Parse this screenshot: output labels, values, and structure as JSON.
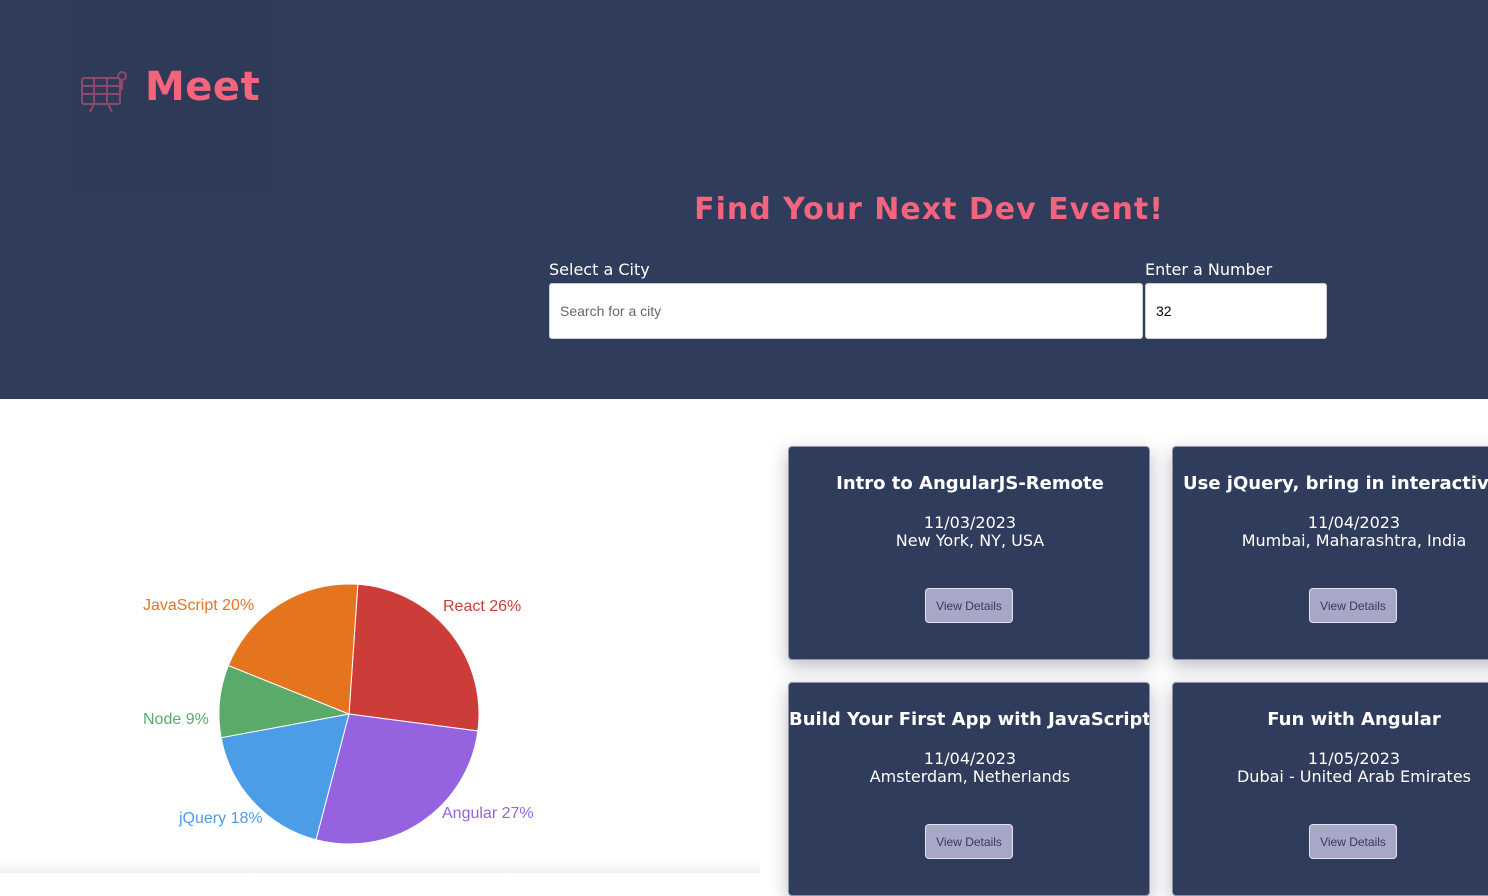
{
  "app": {
    "logo_text": "Meet",
    "headline": "Find Your Next Dev Event!"
  },
  "search": {
    "city_label": "Select a City",
    "city_placeholder": "Search for a city",
    "city_value": "",
    "number_label": "Enter a Number",
    "number_value": "32"
  },
  "chart_data": {
    "type": "pie",
    "slices": [
      {
        "label": "React",
        "percent": 26,
        "color": "#cc3c38"
      },
      {
        "label": "Angular",
        "percent": 27,
        "color": "#9563e0"
      },
      {
        "label": "jQuery",
        "percent": 18,
        "color": "#4c9de8"
      },
      {
        "label": "Node",
        "percent": 9,
        "color": "#5aab69"
      },
      {
        "label": "JavaScript",
        "percent": 20,
        "color": "#e5741f"
      }
    ]
  },
  "events": [
    {
      "title": "Intro to AngularJS-Remote",
      "date": "11/03/2023",
      "location": "New York, NY, USA",
      "button": "View Details"
    },
    {
      "title": "Use jQuery, bring in interactivity easily",
      "date": "11/04/2023",
      "location": "Mumbai, Maharashtra, India",
      "button": "View Details"
    },
    {
      "title": "Build Your First App with JavaScript",
      "date": "11/04/2023",
      "location": "Amsterdam, Netherlands",
      "button": "View Details"
    },
    {
      "title": "Fun with Angular",
      "date": "11/05/2023",
      "location": "Dubai - United Arab Emirates",
      "button": "View Details"
    }
  ]
}
